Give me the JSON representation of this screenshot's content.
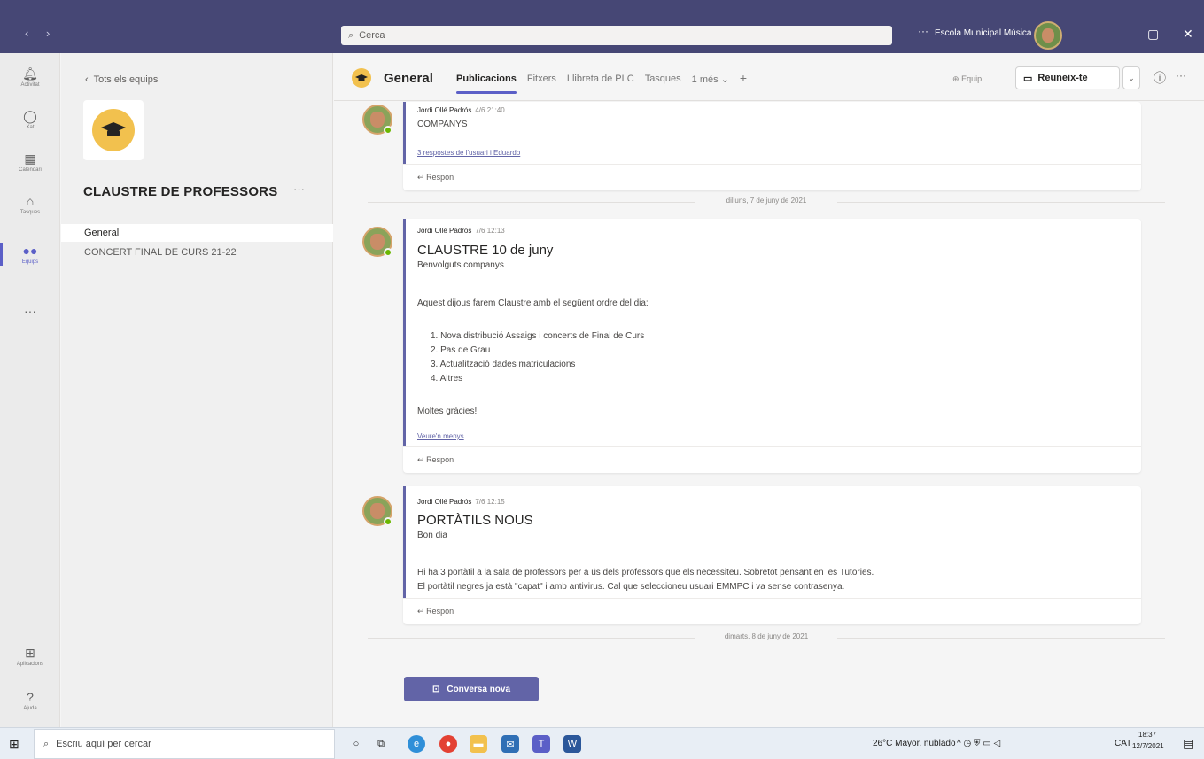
{
  "titlebar": {
    "search_placeholder": "Cerca",
    "org_name": "Escola Municipal Música ..."
  },
  "rail": {
    "items": [
      {
        "label": "Activitat",
        "icon": "bell-icon"
      },
      {
        "label": "Xat",
        "icon": "chat-icon"
      },
      {
        "label": "Calendari",
        "icon": "calendar-icon"
      },
      {
        "label": "Tasques",
        "icon": "backpack-icon"
      },
      {
        "label": "Equips",
        "icon": "teams-icon"
      },
      {
        "label": "Aplicacions",
        "icon": "apps-icon"
      },
      {
        "label": "Ajuda",
        "icon": "help-icon"
      }
    ]
  },
  "teampane": {
    "back_label": "Tots els equips",
    "team_name": "CLAUSTRE DE PROFESSORS",
    "channels": [
      "General",
      "CONCERT FINAL DE CURS 21-22"
    ]
  },
  "channel": {
    "name": "General",
    "tabs": [
      "Publicacions",
      "Fitxers",
      "Llibreta de PLC",
      "Tasques",
      "1 més ⌄"
    ],
    "equip_label": "Equip",
    "meet_label": "Reuneix-te"
  },
  "posts": [
    {
      "author": "Jordi Ollé Padrós",
      "time": "4/6 21:40",
      "body": [
        "COMPANYS"
      ],
      "replies_link": "3 respostes de l'usuari i Eduardo",
      "reply": "Respon"
    },
    {
      "author": "Jordi Ollé Padrós",
      "time": "7/6 12:13",
      "subject": "CLAUSTRE 10 de juny",
      "greeting": "Benvolguts companys",
      "intro": "Aquest dijous farem Claustre amb el següent ordre del dia:",
      "list": [
        "1. Nova distribució Assaigs i concerts de Final de Curs",
        "2. Pas de Grau",
        "3. Actualització dades matriculacions",
        "4. Altres"
      ],
      "closing": "Moltes gràcies!",
      "see_less": "Veure'n menys",
      "reply": "Respon"
    },
    {
      "author": "Jordi Ollé Padrós",
      "time": "7/6 12:15",
      "subject": "PORTÀTILS NOUS",
      "greeting": "Bon dia",
      "lines": [
        "Hi ha 3 portàtil a la sala de professors per a ús dels professors que els necessiteu. Sobretot pensant en les Tutories.",
        "El portàtil negres ja està \"capat\" i amb antivirus. Cal que seleccioneu usuari EMMPC i va sense contrasenya."
      ],
      "reply": "Respon"
    }
  ],
  "separators": [
    "dilluns, 7 de juny de 2021",
    "dimarts, 8 de juny de 2021"
  ],
  "new_conversation": "Conversa nova",
  "taskbar": {
    "search_placeholder": "Escriu aquí per cercar",
    "weather": "26°C  Mayor. nublado",
    "lang": "CAT",
    "time": "18:37",
    "date": "12/7/2021"
  }
}
